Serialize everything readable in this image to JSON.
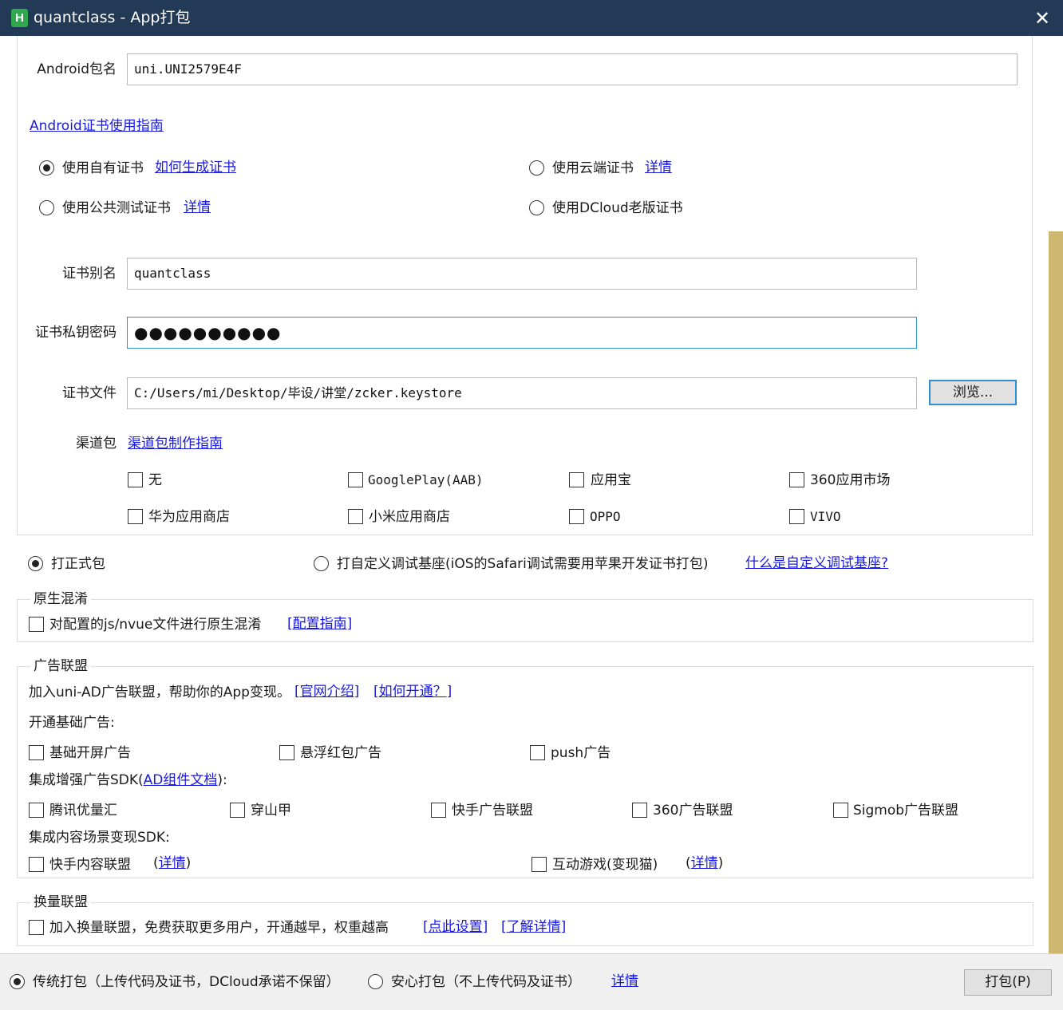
{
  "window": {
    "logo_letter": "H",
    "title": "quantclass - App打包",
    "close_glyph": "✕"
  },
  "android": {
    "package_label": "Android包名",
    "package_value": "uni.UNI2579E4F",
    "cert_guide_link": "Android证书使用指南",
    "cert_options": [
      {
        "label": "使用自有证书",
        "link": "如何生成证书",
        "selected": true
      },
      {
        "label": "使用云端证书",
        "link": "详情",
        "selected": false
      },
      {
        "label": "使用公共测试证书",
        "link": "详情",
        "selected": false
      },
      {
        "label": "使用DCloud老版证书",
        "link": "",
        "selected": false
      }
    ],
    "alias_label": "证书别名",
    "alias_value": "quantclass",
    "password_label": "证书私钥密码",
    "password_value": "●●●●●●●●●●",
    "file_label": "证书文件",
    "file_value": "C:/Users/mi/Desktop/毕设/讲堂/zcker.keystore",
    "browse_button": "浏览...",
    "channel_label": "渠道包",
    "channel_guide_link": "渠道包制作指南",
    "channels": [
      "无",
      "GooglePlay(AAB)",
      "应用宝",
      "360应用市场",
      "华为应用商店",
      "小米应用商店",
      "OPPO",
      "VIVO"
    ]
  },
  "build_type": {
    "release_label": "打正式包",
    "release_selected": true,
    "custom_base_label": "打自定义调试基座(iOS的Safari调试需要用苹果开发证书打包)",
    "custom_base_link": "什么是自定义调试基座?"
  },
  "obfuscation": {
    "title": "原生混淆",
    "checkbox_label": "对配置的js/nvue文件进行原生混淆",
    "guide_link": "[配置指南]"
  },
  "ad_union": {
    "title": "广告联盟",
    "intro": "加入uni-AD广告联盟，帮助你的App变现。",
    "intro_link1": "[官网介绍]",
    "intro_link2": "[如何开通？]",
    "basic_heading": "开通基础广告:",
    "basic_ads": [
      "基础开屏广告",
      "悬浮红包广告",
      "push广告"
    ],
    "sdk_heading_prefix": "集成增强广告SDK(",
    "sdk_heading_link": "AD组件文档",
    "sdk_heading_suffix": "):",
    "sdk_ads": [
      "腾讯优量汇",
      "穿山甲",
      "快手广告联盟",
      "360广告联盟",
      "Sigmob广告联盟"
    ],
    "content_heading": "集成内容场景变现SDK:",
    "content_ads": [
      {
        "label": "快手内容联盟",
        "paren_open": "(",
        "link": "详情",
        "paren_close": ")"
      },
      {
        "label": "互动游戏(变现猫)",
        "paren_open": "(",
        "link": "详情",
        "paren_close": ")"
      }
    ]
  },
  "exchange": {
    "title": "换量联盟",
    "checkbox_label": "加入换量联盟，免费获取更多用户，开通越早，权重越高",
    "link1": "[点此设置]",
    "link2": "[了解详情]"
  },
  "footer": {
    "traditional_label": "传统打包（上传代码及证书，DCloud承诺不保留）",
    "traditional_selected": true,
    "safe_label": "安心打包（不上传代码及证书）",
    "details_link": "详情",
    "pack_button": "打包(P)"
  }
}
